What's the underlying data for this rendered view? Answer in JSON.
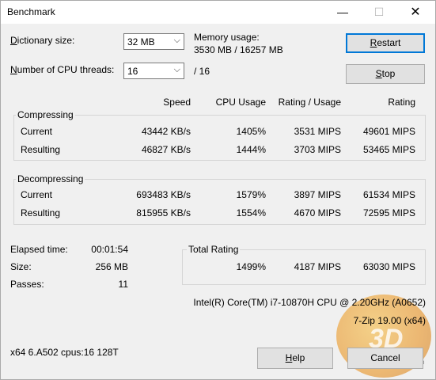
{
  "window": {
    "title": "Benchmark",
    "minimize": "—",
    "maximize": "☐",
    "close": "✕"
  },
  "settings": {
    "dict_label_u": "D",
    "dict_label_rest": "ictionary size:",
    "dict_value": "32 MB",
    "threads_label_u": "N",
    "threads_label_rest": "umber of CPU threads:",
    "threads_value": "16",
    "threads_total": "/ 16",
    "memory_label": "Memory usage:",
    "memory_value": "3530 MB / 16257 MB"
  },
  "buttons": {
    "restart_u": "R",
    "restart_rest": "estart",
    "stop_u": "S",
    "stop_rest": "top",
    "help_u": "H",
    "help_rest": "elp",
    "cancel": "Cancel"
  },
  "columns": {
    "speed": "Speed",
    "cpu": "CPU Usage",
    "rating_usage": "Rating / Usage",
    "rating": "Rating"
  },
  "compressing": {
    "title": "Compressing",
    "current": {
      "label": "Current",
      "speed": "43442 KB/s",
      "cpu": "1405%",
      "ru": "3531 MIPS",
      "rating": "49601 MIPS"
    },
    "resulting": {
      "label": "Resulting",
      "speed": "46827 KB/s",
      "cpu": "1444%",
      "ru": "3703 MIPS",
      "rating": "53465 MIPS"
    }
  },
  "decompressing": {
    "title": "Decompressing",
    "current": {
      "label": "Current",
      "speed": "693483 KB/s",
      "cpu": "1579%",
      "ru": "3897 MIPS",
      "rating": "61534 MIPS"
    },
    "resulting": {
      "label": "Resulting",
      "speed": "815955 KB/s",
      "cpu": "1554%",
      "ru": "4670 MIPS",
      "rating": "72595 MIPS"
    }
  },
  "stats": {
    "elapsed_label": "Elapsed time:",
    "elapsed_value": "00:01:54",
    "size_label": "Size:",
    "size_value": "256 MB",
    "passes_label": "Passes:",
    "passes_value": "11"
  },
  "total": {
    "title": "Total Rating",
    "cpu": "1499%",
    "ru": "4187 MIPS",
    "rating": "63030 MIPS"
  },
  "system": {
    "cpu_name": "Intel(R) Core(TM) i7-10870H CPU @ 2.20GHz (A0652)",
    "version": "7-Zip 19.00 (x64)",
    "arch": "x64 6.A502 cpus:16 128T"
  }
}
